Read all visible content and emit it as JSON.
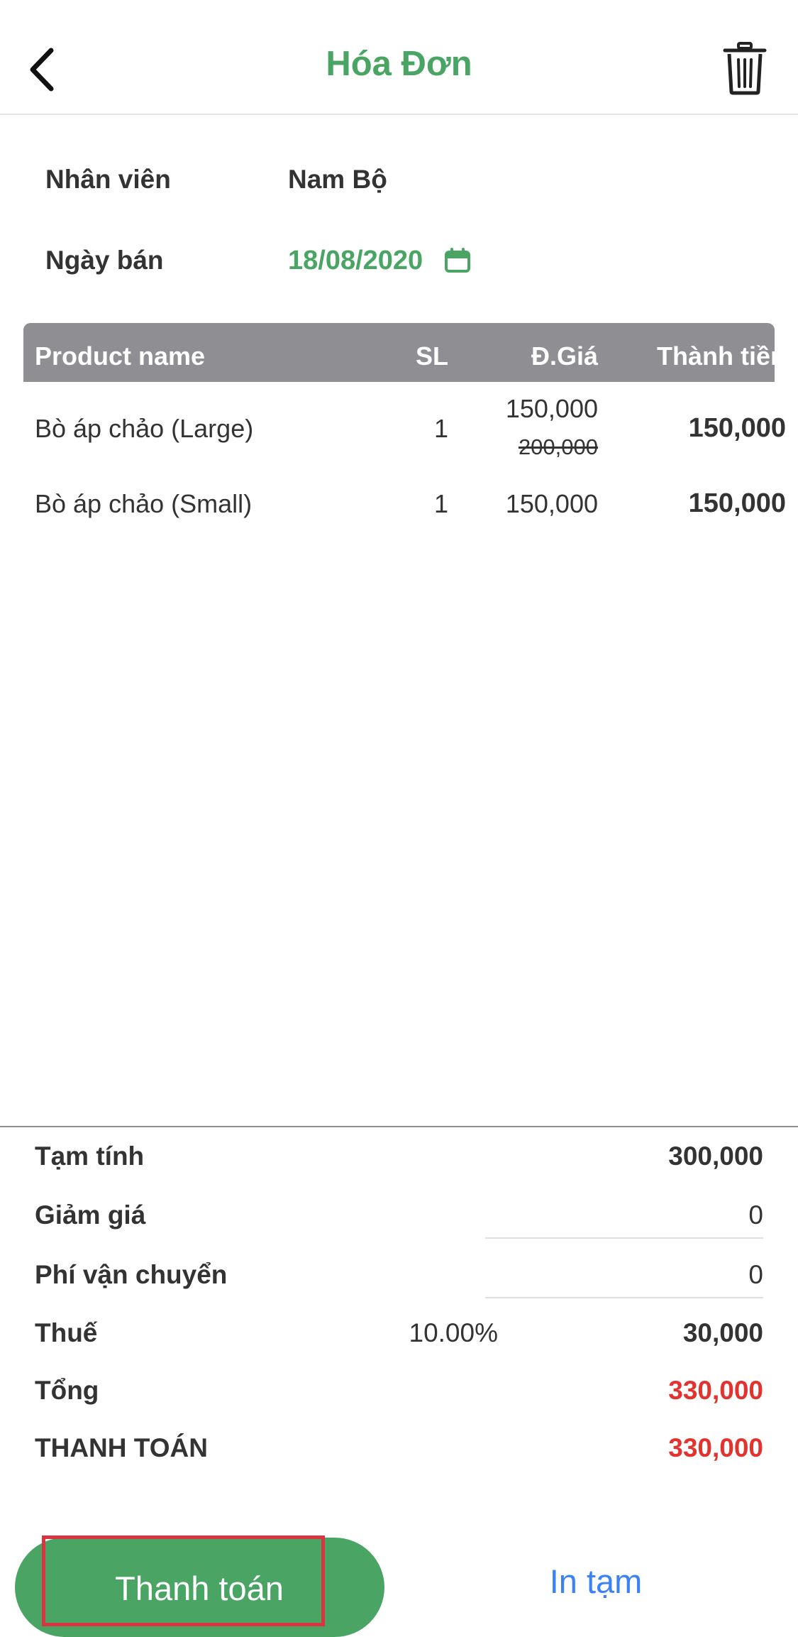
{
  "header": {
    "title": "Hóa Đơn",
    "back_icon": "chevron-left-icon",
    "delete_icon": "trash-icon"
  },
  "info": {
    "staff_label": "Nhân viên",
    "staff_value": "Nam Bộ",
    "date_label": "Ngày bán",
    "date_value": "18/08/2020",
    "date_icon": "calendar-icon"
  },
  "table": {
    "headers": {
      "name": "Product name",
      "qty": "SL",
      "price": "Đ.Giá",
      "total": "Thành tiền"
    },
    "rows": [
      {
        "name": "Bò áp chảo (Large)",
        "qty": "1",
        "price": "150,000",
        "original_price": "200,000",
        "total": "150,000"
      },
      {
        "name": "Bò áp chảo (Small)",
        "qty": "1",
        "price": "150,000",
        "total": "150,000"
      }
    ]
  },
  "totals": {
    "subtotal_label": "Tạm tính",
    "subtotal_value": "300,000",
    "discount_label": "Giảm giá",
    "discount_value": "0",
    "shipping_label": "Phí vận chuyển",
    "shipping_value": "0",
    "tax_label": "Thuế",
    "tax_rate": "10.00%",
    "tax_value": "30,000",
    "total_label": "Tổng",
    "total_value": "330,000",
    "payment_label": "THANH TOÁN",
    "payment_value": "330,000"
  },
  "actions": {
    "pay_label": "Thanh toán",
    "print_label": "In tạm"
  },
  "colors": {
    "brand_green": "#4aa564",
    "table_header_gray": "#8e8e93",
    "total_red": "#e2332f",
    "link_blue": "#3b82f6",
    "highlight_red": "#d9343f"
  }
}
